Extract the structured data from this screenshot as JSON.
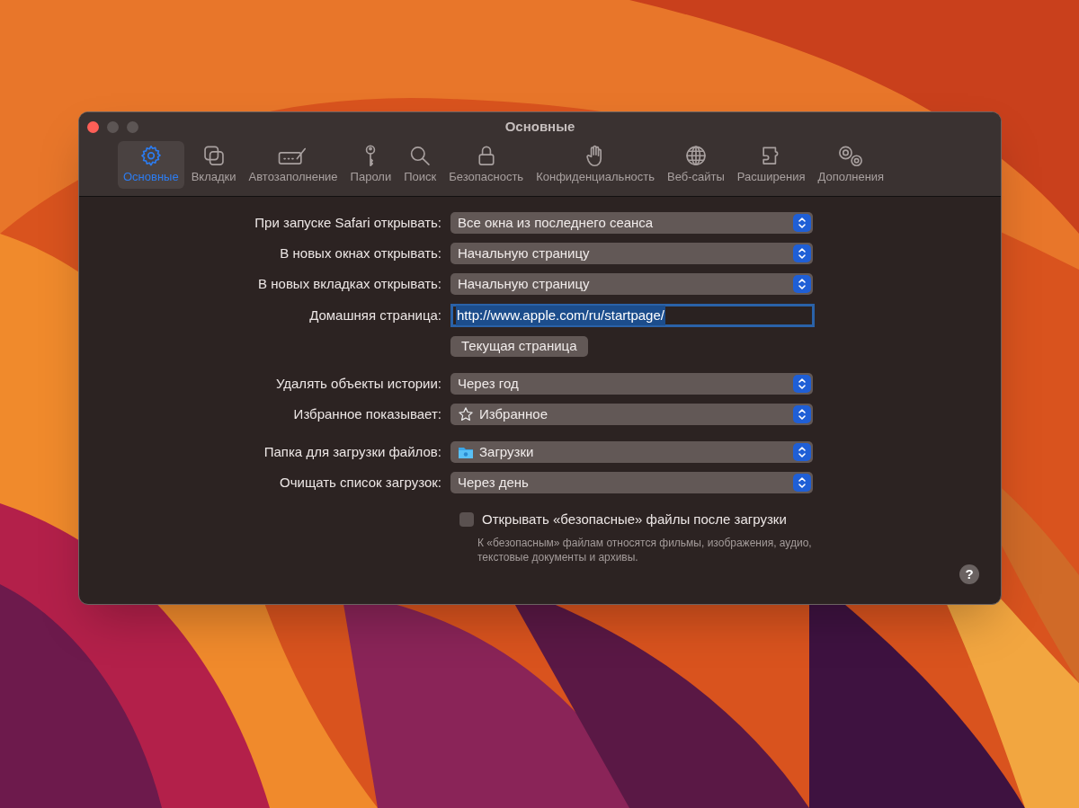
{
  "window": {
    "title": "Основные"
  },
  "tabs": [
    {
      "label": "Основные",
      "selected": true
    },
    {
      "label": "Вкладки",
      "selected": false
    },
    {
      "label": "Автозаполнение",
      "selected": false
    },
    {
      "label": "Пароли",
      "selected": false
    },
    {
      "label": "Поиск",
      "selected": false
    },
    {
      "label": "Безопасность",
      "selected": false
    },
    {
      "label": "Конфиденциальность",
      "selected": false
    },
    {
      "label": "Веб-сайты",
      "selected": false
    },
    {
      "label": "Расширения",
      "selected": false
    },
    {
      "label": "Дополнения",
      "selected": false
    }
  ],
  "groups": [
    [
      {
        "kind": "popup",
        "label": "При запуске Safari открывать:",
        "value": "Все окна из последнего сеанса"
      },
      {
        "kind": "popup",
        "label": "В новых окнах открывать:",
        "value": "Начальную страницу"
      },
      {
        "kind": "popup",
        "label": "В новых вкладках открывать:",
        "value": "Начальную страницу"
      },
      {
        "kind": "field",
        "label": "Домашняя страница:",
        "value": "http://www.apple.com/ru/startpage/",
        "focused": true,
        "text_selected": true
      },
      {
        "kind": "button",
        "value": "Текущая страница"
      }
    ],
    [
      {
        "kind": "popup",
        "label": "Удалять объекты истории:",
        "value": "Через год"
      },
      {
        "kind": "starpopup",
        "label": "Избранное показывает:",
        "value": "Избранное"
      }
    ],
    [
      {
        "kind": "folderpopup",
        "label": "Папка для загрузки файлов:",
        "value": "Загрузки"
      },
      {
        "kind": "popup",
        "label": "Очищать список загрузок:",
        "value": "Через день"
      }
    ]
  ],
  "checkbox": {
    "label": "Открывать «безопасные» файлы после загрузки",
    "checked": false,
    "note": "К «безопасным» файлам относятся фильмы, изображения, аудио, текстовые документы и архивы."
  },
  "help": {
    "label": "?"
  }
}
